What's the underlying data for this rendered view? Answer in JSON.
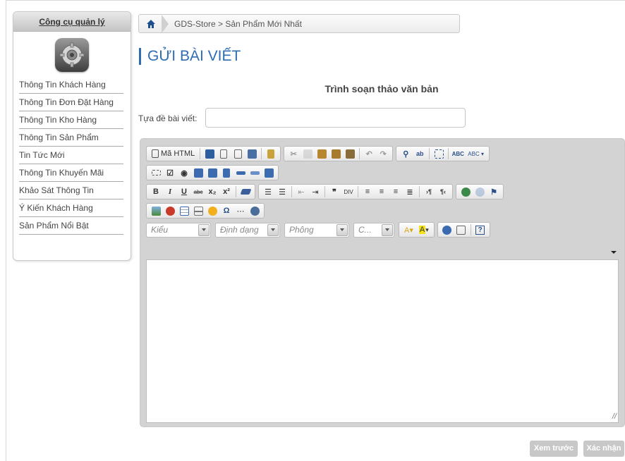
{
  "sidebar": {
    "title": "Công cụ quản lý",
    "items": [
      {
        "label": "Thông Tin Khách Hàng"
      },
      {
        "label": "Thông Tin Đơn Đặt Hàng"
      },
      {
        "label": "Thông Tin Kho Hàng"
      },
      {
        "label": "Thông Tin Sản Phẩm"
      },
      {
        "label": "Tin Tức Mới"
      },
      {
        "label": "Thông Tin Khuyến Mãi"
      },
      {
        "label": "Khảo Sát Thông Tin"
      },
      {
        "label": "Ý Kiến Khách Hàng"
      },
      {
        "label": "Sản Phẩm Nổi Bật"
      }
    ]
  },
  "breadcrumb": {
    "text": "GDS-Store > Sản Phẩm Mới Nhất"
  },
  "page": {
    "title": "GỬI BÀI VIẾT",
    "section_title": "Trình soạn thảo văn bản",
    "title_label": "Tựa đề bài viết:",
    "title_value": ""
  },
  "editor": {
    "source_label": "Mã HTML",
    "combos": {
      "style": "Kiểu",
      "format": "Định dạng",
      "font": "Phông",
      "size": "C..."
    }
  },
  "footer": {
    "preview_label": "Xem trước",
    "submit_label": "Xác nhận"
  },
  "colors": {
    "accent": "#2f6db3",
    "button_gray": "#c8c8c8"
  }
}
